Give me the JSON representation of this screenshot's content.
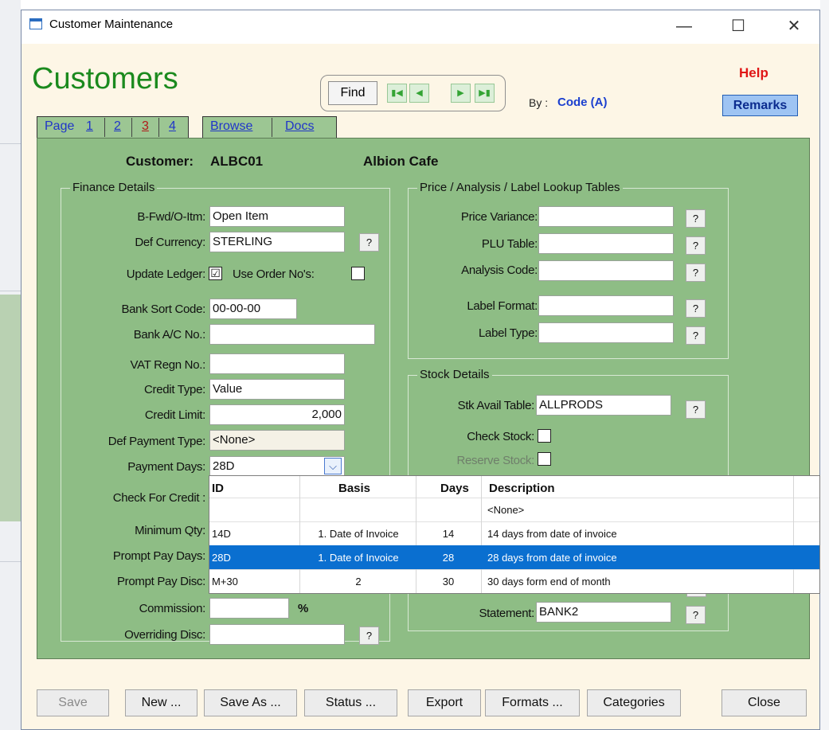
{
  "window": {
    "title": "Customer Maintenance",
    "minimize": "—",
    "maximize": "☐",
    "close": "✕"
  },
  "page": {
    "title": "Customers",
    "help": "Help",
    "remarks": "Remarks"
  },
  "find": {
    "label": "Find",
    "first": "▮◀",
    "prev": "◀",
    "next": "▶",
    "last": "▶▮"
  },
  "sort": {
    "label": "By :",
    "value": "Code (A)"
  },
  "tabs": {
    "page_label": "Page",
    "pages": [
      "1",
      "2",
      "3",
      "4"
    ],
    "browse": "Browse",
    "docs": "Docs"
  },
  "customer": {
    "label": "Customer:",
    "code": "ALBC01",
    "name": "Albion Cafe"
  },
  "finance": {
    "group": "Finance Details",
    "bfwd_label": "B-Fwd/O-Itm:",
    "bfwd": "Open Item",
    "currency_label": "Def Currency:",
    "currency": "STERLING",
    "update_ledger_label": "Update Ledger:",
    "update_ledger": "☑",
    "use_order_label": "Use Order No's:",
    "sort_code_label": "Bank Sort Code:",
    "sort_code": "00-00-00",
    "account_label": "Bank A/C No.:",
    "account": "",
    "vat_label": "VAT Regn No.:",
    "vat": "",
    "credit_type_label": "Credit Type:",
    "credit_type": "Value",
    "credit_limit_label": "Credit Limit:",
    "credit_limit": "2,000",
    "def_payment_label": "Def Payment Type:",
    "def_payment": "<None>",
    "payment_days_label": "Payment Days:",
    "payment_days": "28D",
    "check_credit_label": "Check For Credit :",
    "min_qty_label": "Minimum Qty:",
    "prompt_days_label": "Prompt Pay Days:",
    "prompt_disc_label": "Prompt Pay Disc:",
    "commission_label": "Commission:",
    "commission_unit": "%",
    "overriding_label": "Overriding Disc:"
  },
  "lookup": {
    "group": "Price / Analysis / Label Lookup Tables",
    "price_var_label": "Price Variance:",
    "plu_label": "PLU Table:",
    "analysis_label": "Analysis Code:",
    "label_format_label": "Label Format:",
    "label_type_label": "Label Type:"
  },
  "stock": {
    "group": "Stock Details",
    "avail_label": "Stk Avail Table:",
    "avail": "ALLPRODS",
    "check_label": "Check Stock:",
    "reserve_label": "Reserve Stock:",
    "statement_label": "Statement:",
    "statement": "BANK2"
  },
  "q": "?",
  "dropdown": {
    "headers": [
      "ID",
      "Basis",
      "Days",
      "Description"
    ],
    "rows": [
      [
        "",
        "",
        "",
        "<None>"
      ],
      [
        "14D",
        "1. Date of Invoice",
        "14",
        "14 days from date of invoice"
      ],
      [
        "28D",
        "1. Date of Invoice",
        "28",
        "28 days from date of invoice"
      ],
      [
        "M+30",
        "2",
        "30",
        "30 days form end of month"
      ]
    ],
    "selected": 2,
    "arrow": "⌵"
  },
  "buttons": {
    "save": "Save",
    "new": "New ...",
    "save_as": "Save As ...",
    "status": "Status ...",
    "export": "Export",
    "formats": "Formats ...",
    "categories": "Categories",
    "close": "Close"
  },
  "colors": {
    "panel": "#8ebd85",
    "title_green": "#1b8a1e",
    "selection": "#0a6fd0",
    "help_red": "#e01616"
  }
}
